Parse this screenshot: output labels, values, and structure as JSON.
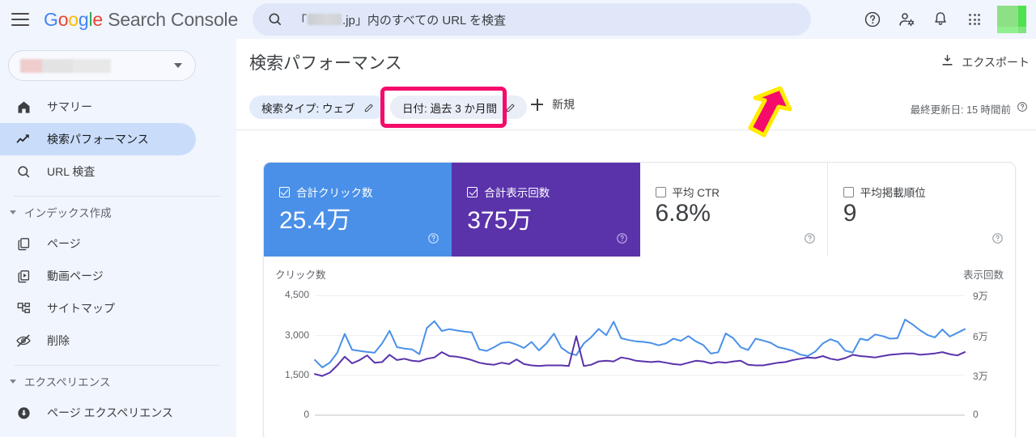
{
  "topbar": {
    "menu_icon": "hamburger-menu-icon",
    "brand": {
      "g": "G",
      "o1": "o",
      "o2": "o",
      "g2": "g",
      "l": "l",
      "e": "e",
      "product": " Search Console"
    },
    "search": {
      "icon": "search-icon",
      "text_prefix": "「",
      "text_suffix": ".jp」内のすべての URL を検査",
      "redacted": true
    },
    "icons": [
      {
        "name": "help-icon",
        "label": "ヘルプ"
      },
      {
        "name": "account-settings-icon",
        "label": "アカウント設定"
      },
      {
        "name": "notifications-bell-icon",
        "label": "通知"
      },
      {
        "name": "apps-grid-icon",
        "label": "Google アプリ"
      }
    ],
    "avatar": {
      "name": "user-avatar",
      "color": "#8ee087"
    },
    "background": "#f1f5fd"
  },
  "sidebar": {
    "property_selector": {
      "redacted": true,
      "caret": "chevron-down-icon"
    },
    "items": [
      {
        "label": "サマリー",
        "icon": "home-icon",
        "active": false
      },
      {
        "label": "検索パフォーマンス",
        "icon": "trending-up-icon",
        "active": true
      },
      {
        "label": "URL 検査",
        "icon": "search-icon",
        "active": false
      }
    ],
    "sections": [
      {
        "title": "インデックス作成",
        "items": [
          {
            "label": "ページ",
            "icon": "pages-icon"
          },
          {
            "label": "動画ページ",
            "icon": "video-page-icon"
          },
          {
            "label": "サイトマップ",
            "icon": "sitemap-icon"
          },
          {
            "label": "削除",
            "icon": "eye-off-icon"
          }
        ]
      },
      {
        "title": "エクスペリエンス",
        "items": [
          {
            "label": "ページ エクスペリエンス",
            "icon": "page-experience-icon"
          }
        ]
      }
    ],
    "active_background": "#c9ddfb"
  },
  "main": {
    "page_title": "検索パフォーマンス",
    "export": {
      "label": "エクスポート",
      "icon": "download-icon"
    },
    "filters": [
      {
        "id": "search-type",
        "label": "検索タイプ: ウェブ",
        "edit_icon": "pencil-icon",
        "highlighted": false
      },
      {
        "id": "date",
        "label": "日付: 過去 3 か月間",
        "edit_icon": "pencil-icon",
        "highlighted": true
      }
    ],
    "new_filter": {
      "label": "新規",
      "icon": "plus-icon"
    },
    "last_updated": {
      "label": "最終更新日: 15 時間前",
      "help_icon": "help-icon"
    },
    "annotation": {
      "type": "arrow",
      "color": "#f50b6b",
      "outline": "#ffed00",
      "points_to": "date"
    },
    "highlight_color": "#f50b6b"
  },
  "metrics": [
    {
      "label": "合計クリック数",
      "value": "25.4万",
      "checked": true,
      "state": "sel-blue",
      "color": "#4a90e8",
      "help_icon": "help-icon"
    },
    {
      "label": "合計表示回数",
      "value": "375万",
      "checked": true,
      "state": "sel-purple",
      "color": "#5a33ab",
      "help_icon": "help-icon"
    },
    {
      "label": "平均 CTR",
      "value": "6.8%",
      "checked": false,
      "state": "",
      "color": "#ffffff",
      "help_icon": "help-icon"
    },
    {
      "label": "平均掲載順位",
      "value": "9",
      "checked": false,
      "state": "",
      "color": "#ffffff",
      "help_icon": "help-icon"
    }
  ],
  "chart_data": {
    "type": "line",
    "title": "",
    "ylabel": "クリック数",
    "y2label": "表示回数",
    "xlabel": "",
    "grid": true,
    "legend": "none",
    "ylim": [
      0,
      5000
    ],
    "y2lim": [
      0,
      100000
    ],
    "yticks": [
      0,
      1500,
      3000,
      4500
    ],
    "yticklabels": [
      "0",
      "1,500",
      "3,000",
      "4,500"
    ],
    "y2ticks": [
      0,
      30000,
      60000,
      90000
    ],
    "y2ticklabels": [
      "0",
      "3万",
      "6万",
      "9万"
    ],
    "series": [
      {
        "name": "クリック数",
        "color": "#4a90e8",
        "axis": "left",
        "values": [
          2080,
          1800,
          1980,
          2350,
          3060,
          2460,
          2420,
          2380,
          2350,
          2700,
          3180,
          2560,
          2510,
          2480,
          2300,
          3280,
          3540,
          3170,
          3240,
          3190,
          3150,
          3120,
          2480,
          2420,
          2560,
          2720,
          2750,
          2660,
          2530,
          2760,
          2440,
          2700,
          3070,
          2540,
          2340,
          2260,
          2700,
          2940,
          3250,
          3010,
          3520,
          2900,
          2830,
          2780,
          2760,
          2720,
          2630,
          2700,
          2880,
          2800,
          2980,
          2780,
          2640,
          2320,
          2370,
          3080,
          2900,
          2560,
          2450,
          2880,
          2810,
          2730,
          2560,
          2500,
          2420,
          2280,
          2230,
          2400,
          2700,
          2860,
          2760,
          2430,
          2360,
          2880,
          2820,
          3040,
          2980,
          2880,
          2900,
          3600,
          3420,
          3200,
          3020,
          2930,
          3230,
          2960,
          3100,
          3240
        ]
      },
      {
        "name": "表示回数",
        "color": "#5a33ab",
        "axis": "right",
        "values": [
          31000,
          29500,
          32000,
          37500,
          44000,
          39000,
          41500,
          45000,
          39500,
          40000,
          45500,
          41500,
          42500,
          41000,
          40500,
          42500,
          43500,
          47500,
          44500,
          44000,
          43000,
          41500,
          39500,
          38500,
          38000,
          39500,
          38500,
          42000,
          38500,
          37500,
          37000,
          37500,
          37500,
          37500,
          37000,
          59500,
          37000,
          38000,
          40500,
          41000,
          40500,
          43500,
          42500,
          41000,
          40500,
          40000,
          40500,
          39500,
          38500,
          38000,
          39500,
          41000,
          40500,
          39000,
          40000,
          39500,
          40500,
          41000,
          38000,
          37500,
          37500,
          38500,
          39500,
          40000,
          41500,
          42500,
          43500,
          43000,
          44500,
          42500,
          41500,
          43000,
          45500,
          44500,
          44000,
          43500,
          44500,
          45500,
          46000,
          46500,
          46500,
          45500,
          46000,
          46500,
          47500,
          46000,
          45000,
          47500
        ]
      }
    ]
  }
}
